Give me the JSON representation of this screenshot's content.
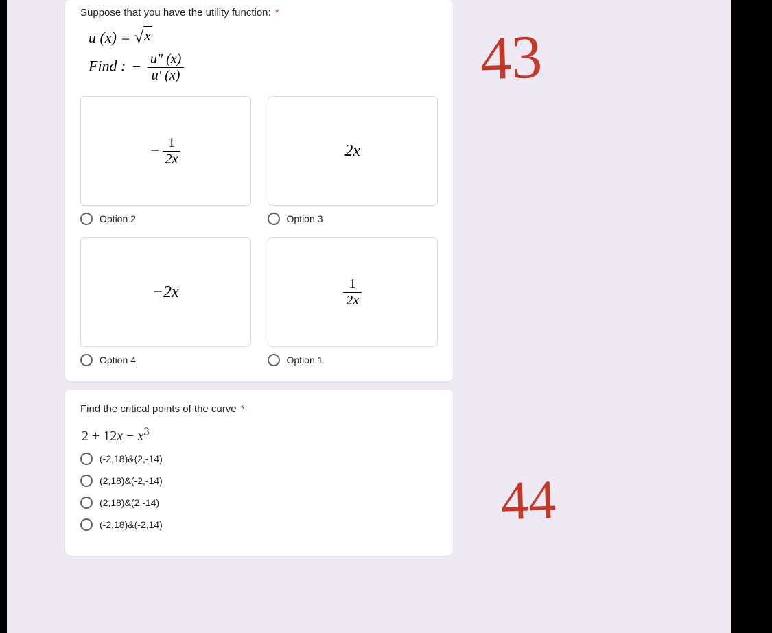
{
  "q43": {
    "title": "Suppose that you have the utility function:",
    "star": "*",
    "math": {
      "u_eq": "u (x) = ",
      "sqrt_arg": "x",
      "find_label": "Find :",
      "neg": "−",
      "num": "u″ (x)",
      "den": "u′ (x)"
    },
    "options": {
      "a_num": "1",
      "a_den": "2x",
      "a_neg": "−",
      "b": "2x",
      "c": "−2x",
      "d_num": "1",
      "d_den": "2x",
      "label2": "Option 2",
      "label3": "Option 3",
      "label4": "Option 4",
      "label1": "Option 1"
    }
  },
  "q44": {
    "title": "Find the critical points of the curve",
    "star": "*",
    "expr": "2 + 12x − x³",
    "opts": {
      "a": "(-2,18)&(2,-14)",
      "b": "(2,18)&(-2,-14)",
      "c": "(2,18)&(2,-14)",
      "d": "(-2,18)&(-2,14)"
    }
  },
  "annot": {
    "n43": "43",
    "n44": "44"
  }
}
